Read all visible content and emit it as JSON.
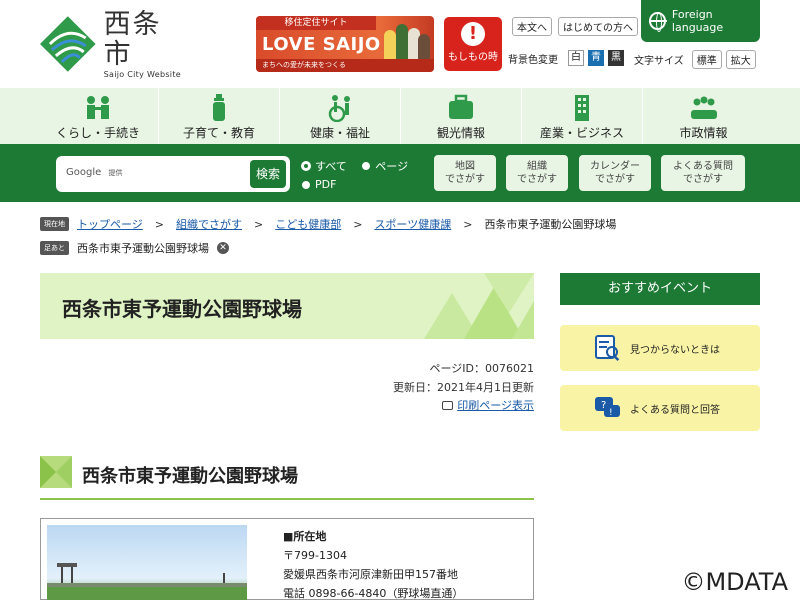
{
  "header": {
    "logo_main": "西条市",
    "logo_sub": "Saijo City Website",
    "banner": {
      "top": "移住定住サイト",
      "main": "LOVE SAIJO",
      "sub": "まちへの愛が未来をつくる"
    },
    "emergency_label": "もしもの時",
    "links": [
      "本文へ",
      "はじめての方へ"
    ],
    "foreign_language": "Foreign language",
    "bg_color_label": "背景色変更",
    "bg_colors": [
      "白",
      "青",
      "黒"
    ],
    "font_size_label": "文字サイズ",
    "font_sizes": [
      "標準",
      "拡大"
    ]
  },
  "nav": {
    "items": [
      {
        "label": "くらし・手続き",
        "icon": "people-icon"
      },
      {
        "label": "子育て・教育",
        "icon": "baby-bottle-icon"
      },
      {
        "label": "健康・福祉",
        "icon": "wheelchair-icon"
      },
      {
        "label": "観光情報",
        "icon": "suitcase-icon"
      },
      {
        "label": "産業・ビジネス",
        "icon": "building-icon"
      },
      {
        "label": "市政情報",
        "icon": "group-icon"
      }
    ]
  },
  "search": {
    "brand": "Google",
    "brand_sub": "提供",
    "button": "検索",
    "options": [
      "すべて",
      "ページ",
      "PDF"
    ],
    "selected": "すべて",
    "finders": [
      {
        "line1": "地図",
        "line2": "でさがす"
      },
      {
        "line1": "組織",
        "line2": "でさがす"
      },
      {
        "line1": "カレンダー",
        "line2": "でさがす"
      },
      {
        "line1": "よくある質問",
        "line2": "でさがす"
      }
    ]
  },
  "breadcrumb": {
    "tag": "現在地",
    "items": [
      "トップページ",
      "組織でさがす",
      "こども健康部",
      "スポーツ健康課"
    ],
    "current": "西条市東予運動公園野球場",
    "history_tag": "足あと",
    "history_item": "西条市東予運動公園野球場"
  },
  "page": {
    "title": "西条市東予運動公園野球場",
    "page_id": "ページID：0076021",
    "updated": "更新日：2021年4月1日更新",
    "print": "印刷ページ表示",
    "section_title": "西条市東予運動公園野球場",
    "info": {
      "heading": "■所在地",
      "postal": "〒799-1304",
      "address": "愛媛県西条市河原津新田甲157番地",
      "phone": "電話 0898-66-4840（野球場直通）"
    }
  },
  "sidebar": {
    "heading": "おすすめイベント",
    "cards": [
      {
        "label": "見つからないときは",
        "icon": "search-document-icon"
      },
      {
        "label": "よくある質問と回答",
        "icon": "faq-icon"
      }
    ]
  },
  "watermark": "©MDATA",
  "colors": {
    "brand_green": "#1d7a35",
    "light_green": "#e8f4e4",
    "title_green": "#dff3c4",
    "accent_lime": "#8bc34a",
    "emergency_red": "#d8231c",
    "sidebar_yellow": "#f9f3a5"
  }
}
